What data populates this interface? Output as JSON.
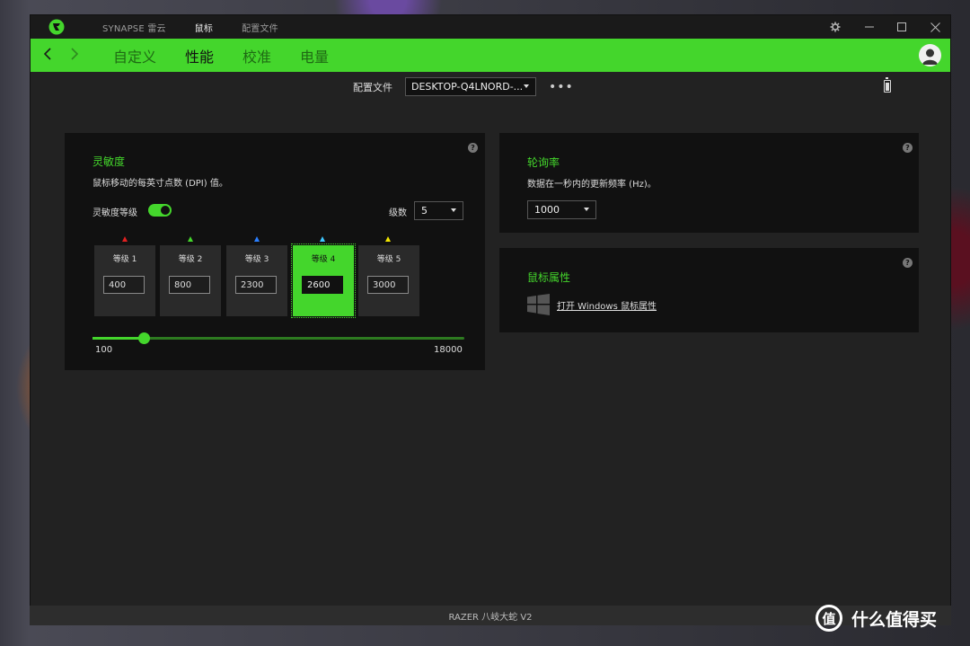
{
  "titlebar": {
    "tabs": [
      "SYNAPSE 雷云",
      "鼠标",
      "配置文件"
    ],
    "active_tab": 1
  },
  "nav": {
    "tabs": [
      "自定义",
      "性能",
      "校准",
      "电量"
    ],
    "active_tab": 1
  },
  "profile": {
    "label": "配置文件",
    "value": "DESKTOP-Q4LNORD-...",
    "more": "•••"
  },
  "sensitivity": {
    "title": "灵敏度",
    "description": "鼠标移动的每英寸点数 (DPI) 值。",
    "toggle_label": "灵敏度等级",
    "toggle_on": true,
    "levels_label": "级数",
    "levels_value": "5",
    "stages": [
      {
        "label": "等级 1",
        "value": "400",
        "color": "#e02020"
      },
      {
        "label": "等级 2",
        "value": "800",
        "color": "#44d62c"
      },
      {
        "label": "等级 3",
        "value": "2300",
        "color": "#2a7fff"
      },
      {
        "label": "等级 4",
        "value": "2600",
        "color": "#3ec7ff"
      },
      {
        "label": "等级 5",
        "value": "3000",
        "color": "#f2e600"
      }
    ],
    "active_stage": 3,
    "slider_min": "100",
    "slider_max": "18000",
    "slider_value": 2600
  },
  "polling": {
    "title": "轮询率",
    "description": "数据在一秒内的更新频率 (Hz)。",
    "value": "1000"
  },
  "mouse_props": {
    "title": "鼠标属性",
    "link": "打开 Windows 鼠标属性"
  },
  "help_icon": "?",
  "device_name": "RAZER 八岐大蛇 V2",
  "watermark": {
    "logo": "值",
    "text": "什么值得买"
  },
  "colors": {
    "accent": "#44d62c",
    "panel": "#111111",
    "window": "#222222"
  }
}
